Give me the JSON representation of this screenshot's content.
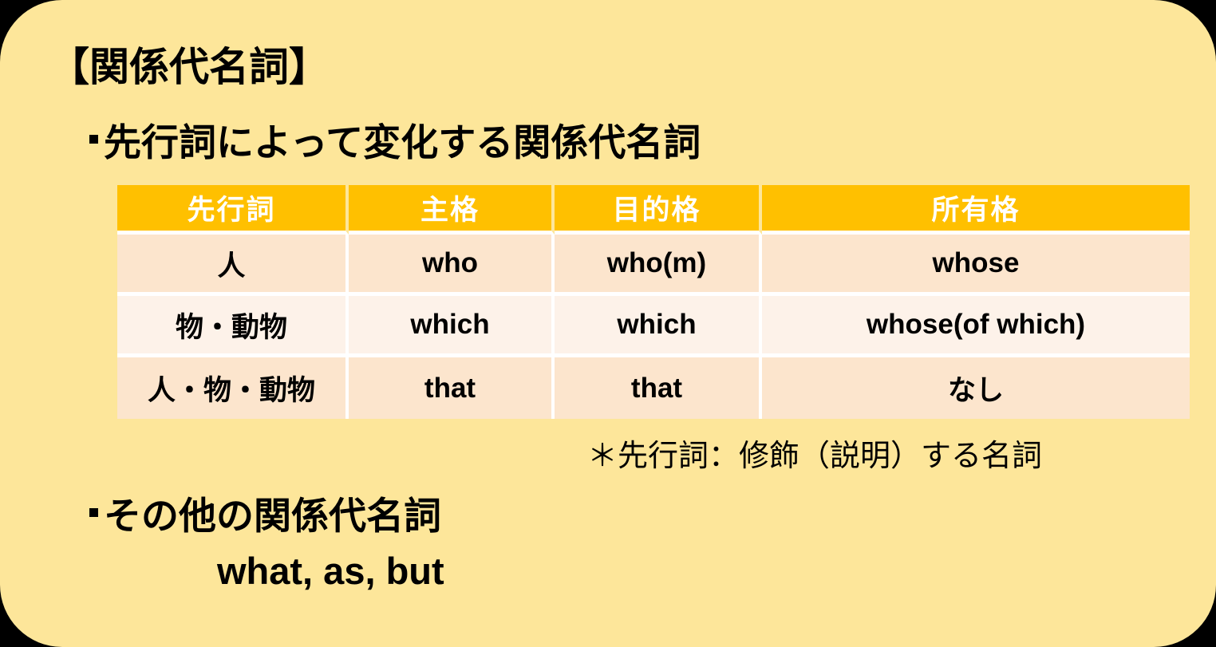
{
  "card": {
    "background_color": "#FDE69A",
    "outside_color": "#000000"
  },
  "title": "【関係代名詞】",
  "section1": {
    "heading": "先行詞によって変化する関係代名詞",
    "table": {
      "header_bg_color": "#FFC000",
      "header_text_color": "#FFFFFF",
      "row_odd_bg_color": "#FCE5CD",
      "row_even_bg_color": "#FDF2E9",
      "columns": [
        "先行詞",
        "主格",
        "目的格",
        "所有格"
      ],
      "rows": [
        [
          "人",
          "who",
          "who(m)",
          "whose"
        ],
        [
          "物・動物",
          "which",
          "which",
          "whose(of which)"
        ],
        [
          "人・物・動物",
          "that",
          "that",
          "なし"
        ]
      ]
    },
    "footnote": "＊先行詞：修飾（説明）する名詞"
  },
  "section2": {
    "heading": "その他の関係代名詞",
    "words": "what, as, but"
  }
}
